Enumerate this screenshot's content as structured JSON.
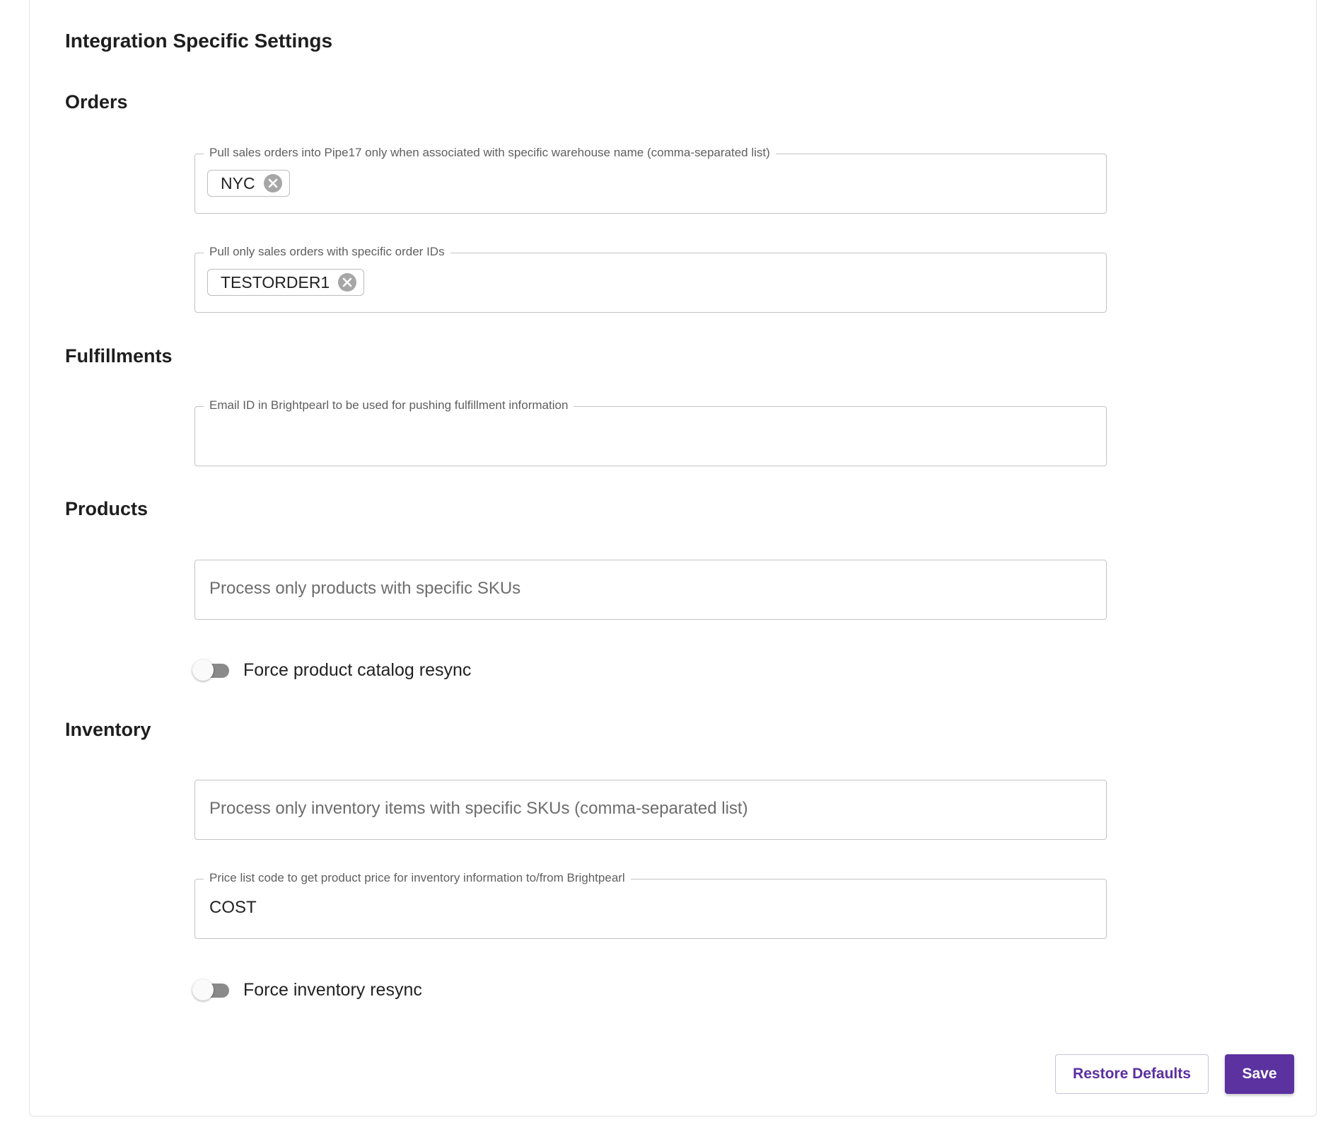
{
  "page": {
    "title": "Integration Specific Settings"
  },
  "sections": {
    "orders": {
      "title": "Orders",
      "warehouse_field": {
        "label": "Pull sales orders into Pipe17 only when associated with specific warehouse name (comma-separated list)",
        "chips": [
          "NYC"
        ]
      },
      "order_ids_field": {
        "label": "Pull only sales orders with specific order IDs",
        "chips": [
          "TESTORDER1"
        ]
      }
    },
    "fulfillments": {
      "title": "Fulfillments",
      "email_field": {
        "label": "Email ID in Brightpearl to be used for pushing fulfillment information",
        "value": ""
      }
    },
    "products": {
      "title": "Products",
      "sku_field": {
        "placeholder": "Process only products with specific SKUs"
      },
      "resync_toggle": {
        "label": "Force product catalog resync",
        "checked": false
      }
    },
    "inventory": {
      "title": "Inventory",
      "sku_field": {
        "placeholder": "Process only inventory items with specific SKUs (comma-separated list)"
      },
      "price_list_field": {
        "label": "Price list code to get product price for inventory information to/from Brightpearl",
        "value": "COST"
      },
      "resync_toggle": {
        "label": "Force inventory resync",
        "checked": false
      }
    }
  },
  "actions": {
    "restore_label": "Restore Defaults",
    "save_label": "Save"
  },
  "icons": {
    "chip_remove": "close-circle-icon"
  },
  "colors": {
    "accent": "#5b32a0",
    "toggle_off_track": "#8a8a8a",
    "border": "#c4c4c4"
  }
}
